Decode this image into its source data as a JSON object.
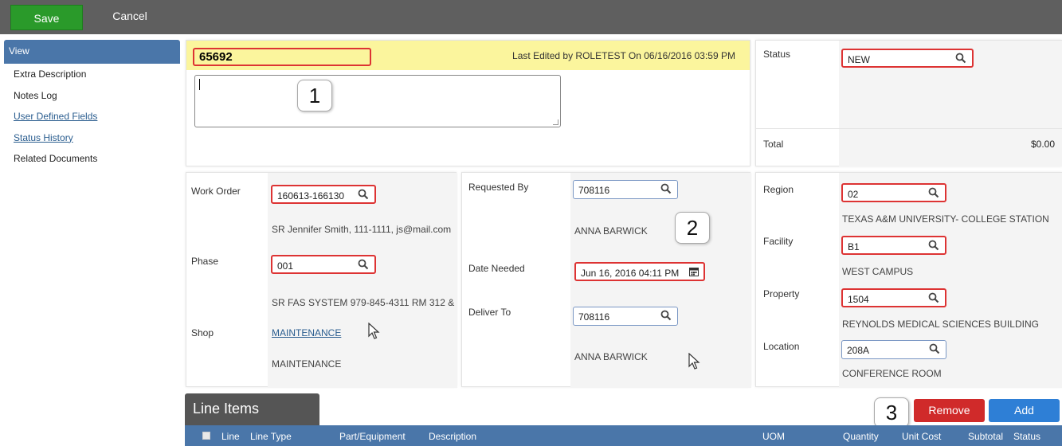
{
  "toolbar": {
    "save_label": "Save",
    "cancel_label": "Cancel"
  },
  "sidebar": {
    "view_label": "View",
    "items": [
      {
        "label": "Extra Description",
        "link": false
      },
      {
        "label": "Notes Log",
        "link": false
      },
      {
        "label": "User Defined Fields",
        "link": true
      },
      {
        "label": "Status History",
        "link": true
      },
      {
        "label": "Related Documents",
        "link": false
      }
    ]
  },
  "header": {
    "number": "65692",
    "last_edited": "Last Edited by ROLETEST On 06/16/2016 03:59 PM",
    "description_value": ""
  },
  "status_panel": {
    "status_label": "Status",
    "status_value": "NEW",
    "total_label": "Total",
    "total_value": "$0.00"
  },
  "work_order_panel": {
    "work_order_label": "Work Order",
    "work_order_value": "160613-166130",
    "work_order_desc": "SR Jennifer Smith, 111-1111, js@mail.com",
    "phase_label": "Phase",
    "phase_value": "001",
    "phase_desc": "SR FAS SYSTEM 979-845-4311 RM 312 &",
    "shop_label": "Shop",
    "shop_link": "MAINTENANCE",
    "shop_desc": "MAINTENANCE"
  },
  "request_panel": {
    "requested_by_label": "Requested By",
    "requested_by_value": "708116",
    "requested_by_name": "ANNA BARWICK",
    "date_needed_label": "Date Needed",
    "date_needed_value": "Jun 16, 2016 04:11 PM",
    "deliver_to_label": "Deliver To",
    "deliver_to_value": "708116",
    "deliver_to_name": "ANNA BARWICK"
  },
  "location_panel": {
    "region_label": "Region",
    "region_value": "02",
    "region_desc": "TEXAS A&M UNIVERSITY- COLLEGE STATION",
    "facility_label": "Facility",
    "facility_value": "B1",
    "facility_desc": "WEST CAMPUS",
    "property_label": "Property",
    "property_value": "1504",
    "property_desc": "REYNOLDS MEDICAL SCIENCES BUILDING",
    "location_label": "Location",
    "location_value": "208A",
    "location_desc": "CONFERENCE ROOM"
  },
  "callouts": {
    "one": "1",
    "two": "2",
    "three": "3"
  },
  "line_items": {
    "tab_label": "Line Items",
    "remove_label": "Remove",
    "add_label": "Add",
    "columns": [
      "Line",
      "Line Type",
      "Part/Equipment",
      "Description",
      "UOM",
      "Quantity",
      "Unit Cost",
      "Subtotal",
      "Status"
    ]
  },
  "icons": {
    "search": "magnifier-icon",
    "calendar": "calendar-icon",
    "cursor": "mouse-pointer-icon"
  },
  "colors": {
    "save": "#2a9a2a",
    "remove": "#d02a2a",
    "add": "#2e7fd6",
    "highlight_border": "#dd3333",
    "header_blue": "#4a76a9",
    "yellow": "#fbf59d"
  }
}
